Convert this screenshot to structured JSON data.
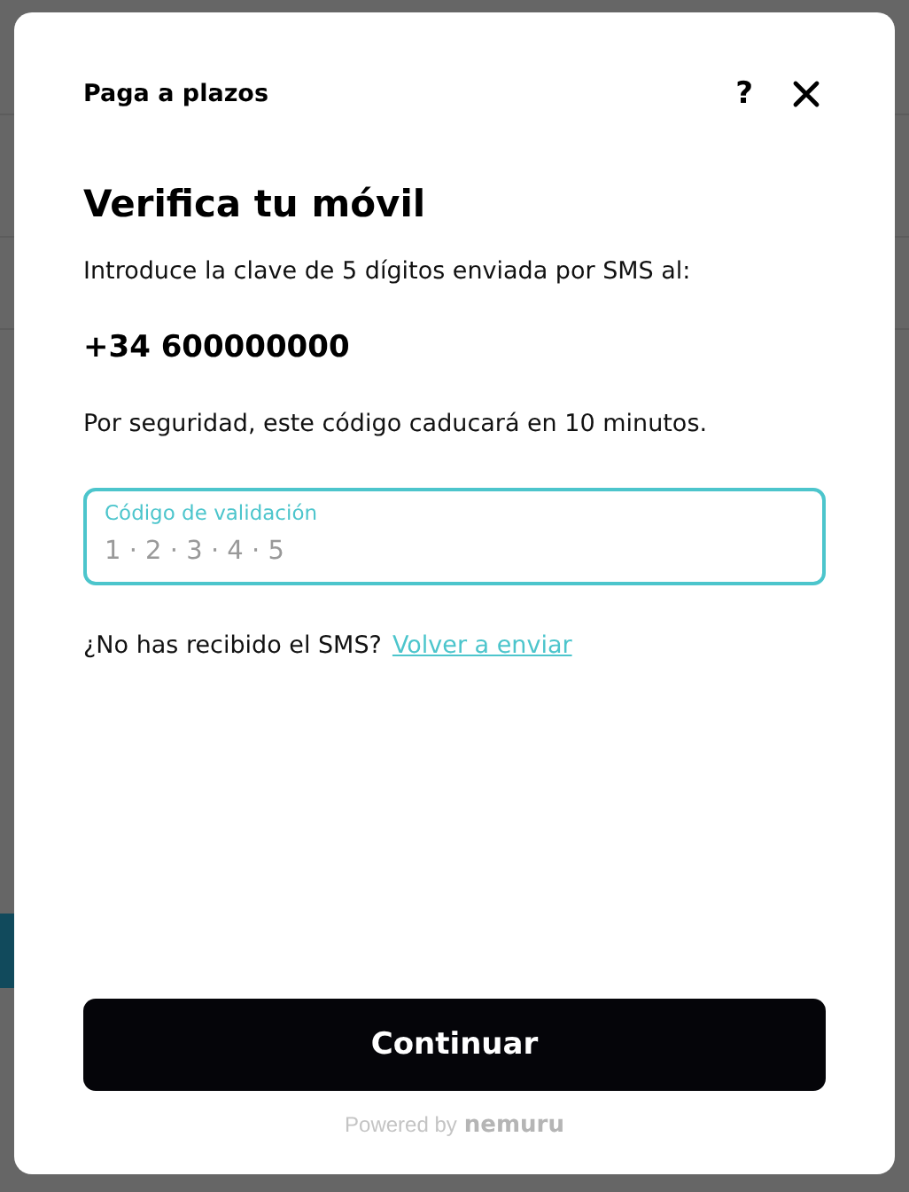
{
  "modal": {
    "brand_title": "Paga a plazos",
    "help_button": "?",
    "title": "Verifica tu móvil",
    "intro": "Introduce la clave de 5 dígitos enviada por SMS al:",
    "phone": "+34 600000000",
    "notice": "Por seguridad, este código caducará en 10 minutos.",
    "code_field": {
      "label": "Código de validación",
      "placeholder": "1 · 2 · 3 · 4 · 5",
      "focused": true
    },
    "resend_prompt": "¿No has recibido el SMS?",
    "resend_link": "Volver a enviar",
    "submit_button": "Continuar",
    "footer": {
      "powered_by": "Powered by",
      "brand": "nemuru"
    }
  }
}
